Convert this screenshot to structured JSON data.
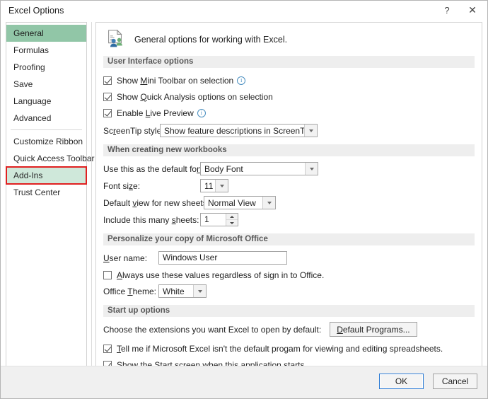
{
  "window": {
    "title": "Excel Options",
    "help_label": "?",
    "close_label": "✕"
  },
  "sidebar": {
    "items": [
      {
        "label": "General",
        "state": "selected"
      },
      {
        "label": "Formulas",
        "state": "normal"
      },
      {
        "label": "Proofing",
        "state": "normal"
      },
      {
        "label": "Save",
        "state": "normal"
      },
      {
        "label": "Language",
        "state": "normal"
      },
      {
        "label": "Advanced",
        "state": "normal"
      },
      {
        "label": "Customize Ribbon",
        "state": "normal"
      },
      {
        "label": "Quick Access Toolbar",
        "state": "normal"
      },
      {
        "label": "Add-Ins",
        "state": "highlighted"
      },
      {
        "label": "Trust Center",
        "state": "normal"
      }
    ],
    "highlight_color": "#e02020",
    "selected_color": "#91c6a7",
    "highlighted_bg": "#cfe8da"
  },
  "content": {
    "header": {
      "icon": "general-options-icon",
      "caption": "General options for working with Excel."
    },
    "user_interface": {
      "title": "User Interface options",
      "mini_toolbar": {
        "label_pre": "Show ",
        "label_accel": "M",
        "label_post": "ini Toolbar on selection",
        "checked": true,
        "info": "ⓘ"
      },
      "quick_analysis": {
        "label_pre": "Show ",
        "label_accel": "Q",
        "label_post": "uick Analysis options on selection",
        "checked": true
      },
      "live_preview": {
        "label_pre": "Enable ",
        "label_accel": "L",
        "label_post": "ive Preview",
        "checked": true,
        "info": "ⓘ"
      },
      "screentip": {
        "label_pre": "Sc",
        "label_accel": "r",
        "label_post": "eenTip style:",
        "value": "Show feature descriptions in ScreenTips"
      }
    },
    "new_workbooks": {
      "title": "When creating new workbooks",
      "default_font": {
        "label_pre": "Use this as the default fo",
        "label_accel": "n",
        "label_post": "t:",
        "value": "Body Font"
      },
      "font_size": {
        "label_pre": "Font si",
        "label_accel": "z",
        "label_post": "e:",
        "value": "11"
      },
      "default_view": {
        "label_pre": "Default ",
        "label_accel": "v",
        "label_post": "iew for new sheets:",
        "value": "Normal View"
      },
      "sheet_count": {
        "label_pre": "Include this many ",
        "label_accel": "s",
        "label_post": "heets:",
        "value": "1"
      }
    },
    "personalize": {
      "title": "Personalize your copy of Microsoft Office",
      "user_name": {
        "label_pre": "",
        "label_accel": "U",
        "label_post": "ser name:",
        "value": "Windows User"
      },
      "always_use": {
        "label_pre": "",
        "label_accel": "A",
        "label_post": "lways use these values regardless of sign in to Office.",
        "checked": false
      },
      "office_theme": {
        "label_pre": "Office ",
        "label_accel": "T",
        "label_post": "heme:",
        "value": "White"
      }
    },
    "startup": {
      "title": "Start up options",
      "extensions_label": "Choose the extensions you want Excel to open by default:",
      "default_programs_button": {
        "label_accel": "D",
        "label_post": "efault Programs..."
      },
      "tell_me": {
        "label_pre": "",
        "label_accel": "T",
        "label_post": "ell me if Microsoft Excel isn't the default progam for viewing and editing spreadsheets.",
        "checked": true
      },
      "show_start_screen": {
        "label_pre": "",
        "label_accel": "S",
        "label_post": "how the Start screen when this application starts",
        "checked": true
      }
    }
  },
  "footer": {
    "ok_label": "OK",
    "cancel_label": "Cancel"
  }
}
